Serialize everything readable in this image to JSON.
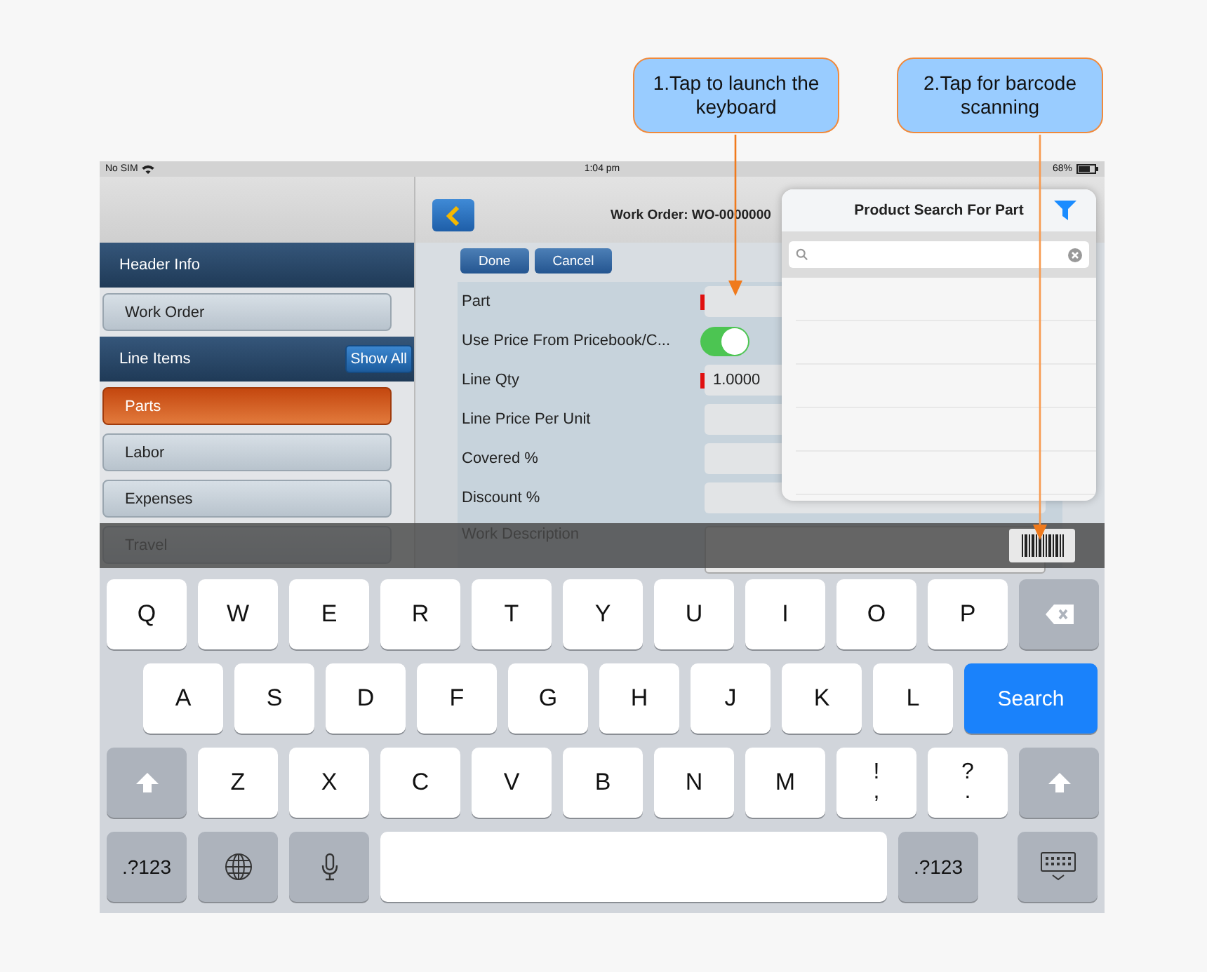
{
  "callouts": [
    {
      "text": "1.Tap to launch the keyboard"
    },
    {
      "text": "2.Tap for barcode scanning"
    }
  ],
  "status_bar": {
    "carrier": "No SIM",
    "time": "1:04 pm",
    "battery": "68%"
  },
  "sidebar": {
    "sections": [
      {
        "title": "Header Info",
        "items": [
          {
            "label": "Work Order",
            "selected": false
          }
        ]
      },
      {
        "title": "Line Items",
        "action": "Show All",
        "items": [
          {
            "label": "Parts",
            "selected": true
          },
          {
            "label": "Labor",
            "selected": false
          },
          {
            "label": "Expenses",
            "selected": false
          },
          {
            "label": "Travel",
            "selected": false
          }
        ]
      }
    ]
  },
  "nav": {
    "title": "Work Order: WO-0000000"
  },
  "form": {
    "buttons": [
      "Done",
      "Cancel"
    ],
    "fields": [
      {
        "kind": "text",
        "label": "Part",
        "required": true
      },
      {
        "kind": "toggle",
        "label": "Use Price From Pricebook/C...",
        "on": true
      },
      {
        "kind": "text",
        "label": "Line Qty",
        "required": true,
        "value": "1.0000"
      },
      {
        "kind": "text",
        "label": "Line Price Per Unit"
      },
      {
        "kind": "text",
        "label": "Covered %"
      },
      {
        "kind": "text",
        "label": "Discount %"
      },
      {
        "kind": "textarea",
        "label": "Work Description"
      }
    ]
  },
  "popover": {
    "title": "Product Search For Part"
  },
  "keyboard": {
    "rows": [
      [
        {
          "kind": "letter",
          "label": "Q"
        },
        {
          "kind": "letter",
          "label": "W"
        },
        {
          "kind": "letter",
          "label": "E"
        },
        {
          "kind": "letter",
          "label": "R"
        },
        {
          "kind": "letter",
          "label": "T"
        },
        {
          "kind": "letter",
          "label": "Y"
        },
        {
          "kind": "letter",
          "label": "U"
        },
        {
          "kind": "letter",
          "label": "I"
        },
        {
          "kind": "letter",
          "label": "O"
        },
        {
          "kind": "letter",
          "label": "P"
        },
        {
          "kind": "backspace"
        }
      ],
      [
        {
          "kind": "letter",
          "label": "A"
        },
        {
          "kind": "letter",
          "label": "S"
        },
        {
          "kind": "letter",
          "label": "D"
        },
        {
          "kind": "letter",
          "label": "F"
        },
        {
          "kind": "letter",
          "label": "G"
        },
        {
          "kind": "letter",
          "label": "H"
        },
        {
          "kind": "letter",
          "label": "J"
        },
        {
          "kind": "letter",
          "label": "K"
        },
        {
          "kind": "letter",
          "label": "L"
        },
        {
          "kind": "action",
          "label": "Search"
        }
      ],
      [
        {
          "kind": "shift"
        },
        {
          "kind": "letter",
          "label": "Z"
        },
        {
          "kind": "letter",
          "label": "X"
        },
        {
          "kind": "letter",
          "label": "C"
        },
        {
          "kind": "letter",
          "label": "V"
        },
        {
          "kind": "letter",
          "label": "B"
        },
        {
          "kind": "letter",
          "label": "N"
        },
        {
          "kind": "letter",
          "label": "M"
        },
        {
          "kind": "dual",
          "top": "!",
          "bottom": ","
        },
        {
          "kind": "dual",
          "top": "?",
          "bottom": "."
        },
        {
          "kind": "shift"
        }
      ],
      [
        {
          "kind": "mode",
          "label": ".?123"
        },
        {
          "kind": "globe"
        },
        {
          "kind": "mic"
        },
        {
          "kind": "space"
        },
        {
          "kind": "mode",
          "label": ".?123"
        },
        {
          "kind": "hide"
        }
      ]
    ]
  }
}
